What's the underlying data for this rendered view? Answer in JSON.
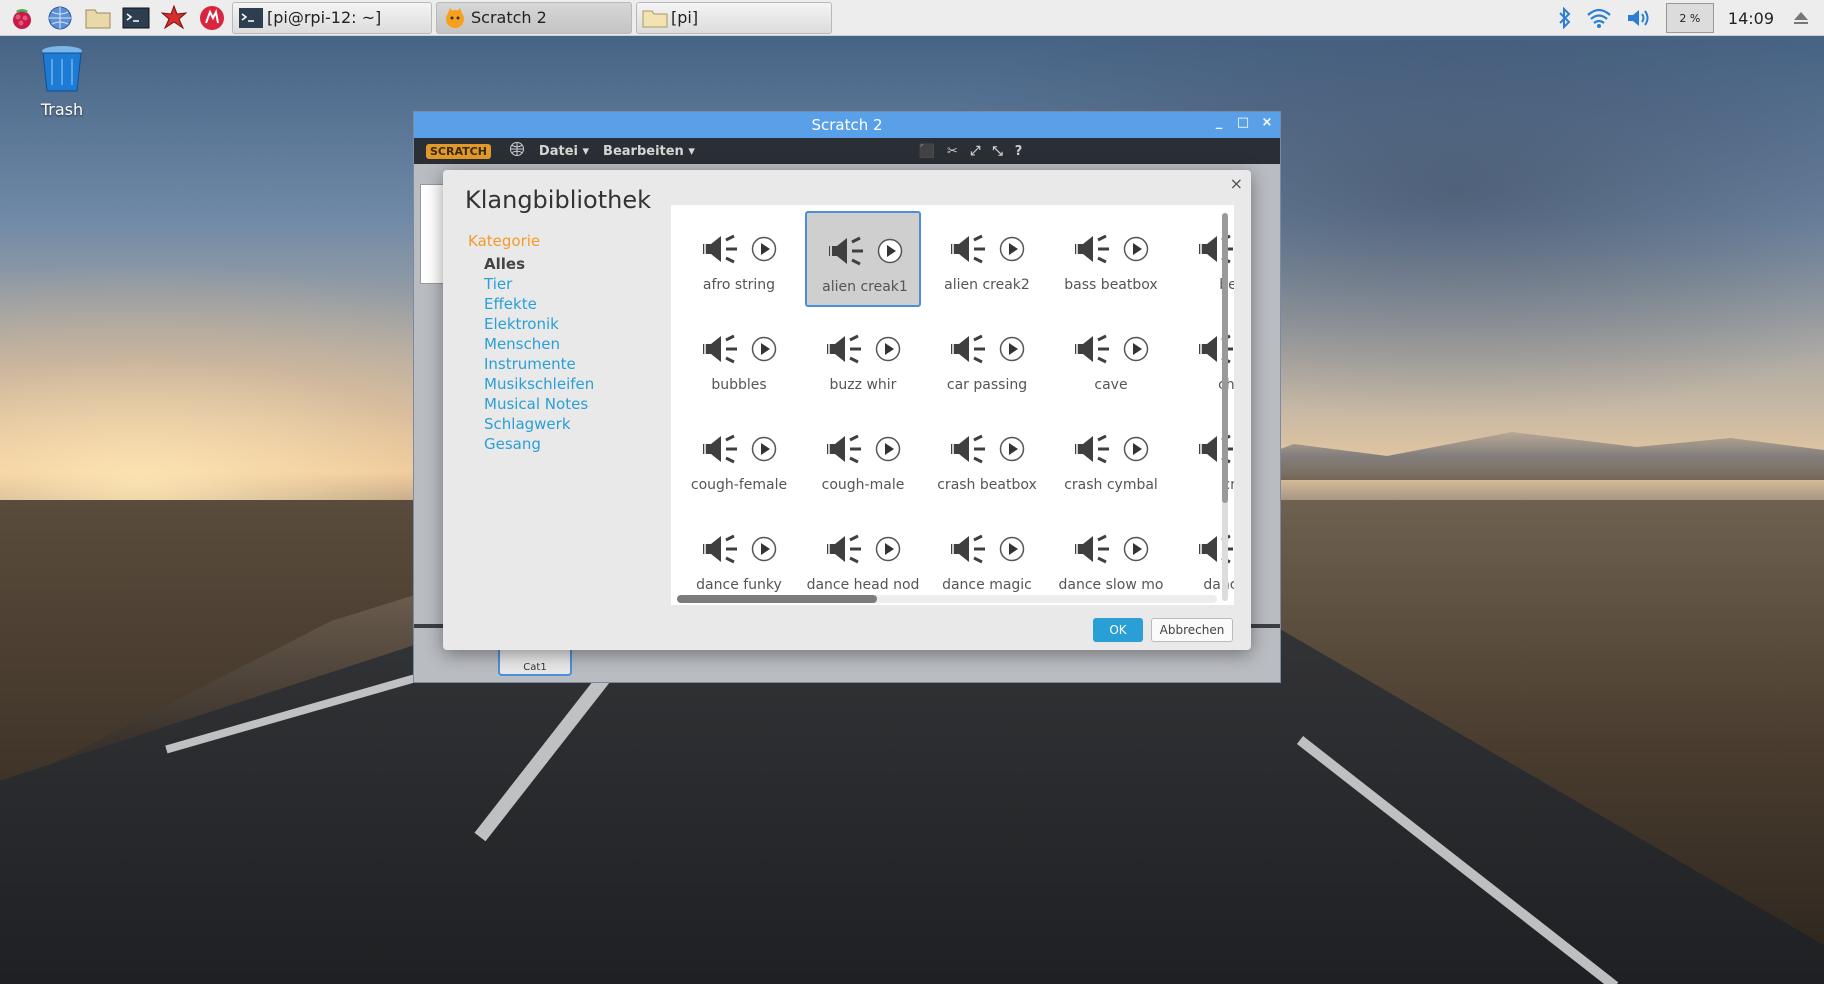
{
  "taskbar": {
    "tasks": [
      {
        "label": "[pi@rpi-12: ~]"
      },
      {
        "label": "Scratch 2"
      },
      {
        "label": "[pi]"
      }
    ],
    "cpu": "2 %",
    "clock": "14:09"
  },
  "desktop": {
    "trash_label": "Trash"
  },
  "window": {
    "title": "Scratch 2",
    "menu": {
      "logo": "SCRATCH",
      "file": "Datei ▾",
      "edit": "Bearbeiten ▾"
    },
    "sprite_name": "Cat1"
  },
  "dialog": {
    "title": "Klangbibliothek",
    "close": "×",
    "category_header": "Kategorie",
    "categories": [
      "Alles",
      "Tier",
      "Effekte",
      "Elektronik",
      "Menschen",
      "Instrumente",
      "Musikschleifen",
      "Musical Notes",
      "Schlagwerk",
      "Gesang"
    ],
    "selected_category": "Alles",
    "sounds": [
      [
        "afro string",
        "alien creak1",
        "alien creak2",
        "bass beatbox",
        "beat"
      ],
      [
        "bubbles",
        "buzz whir",
        "car passing",
        "cave",
        "chee"
      ],
      [
        "cough-female",
        "cough-male",
        "crash beatbox",
        "crash cymbal",
        "cric"
      ],
      [
        "dance funky",
        "dance head nod",
        "dance magic",
        "dance slow mo",
        "dance sn"
      ]
    ],
    "selected_sound": "alien creak1",
    "ok_label": "OK",
    "cancel_label": "Abbrechen"
  },
  "colors": {
    "accent": "#2a9fd6",
    "category_header": "#f59a2a",
    "titlebar": "#5aa0e8"
  }
}
